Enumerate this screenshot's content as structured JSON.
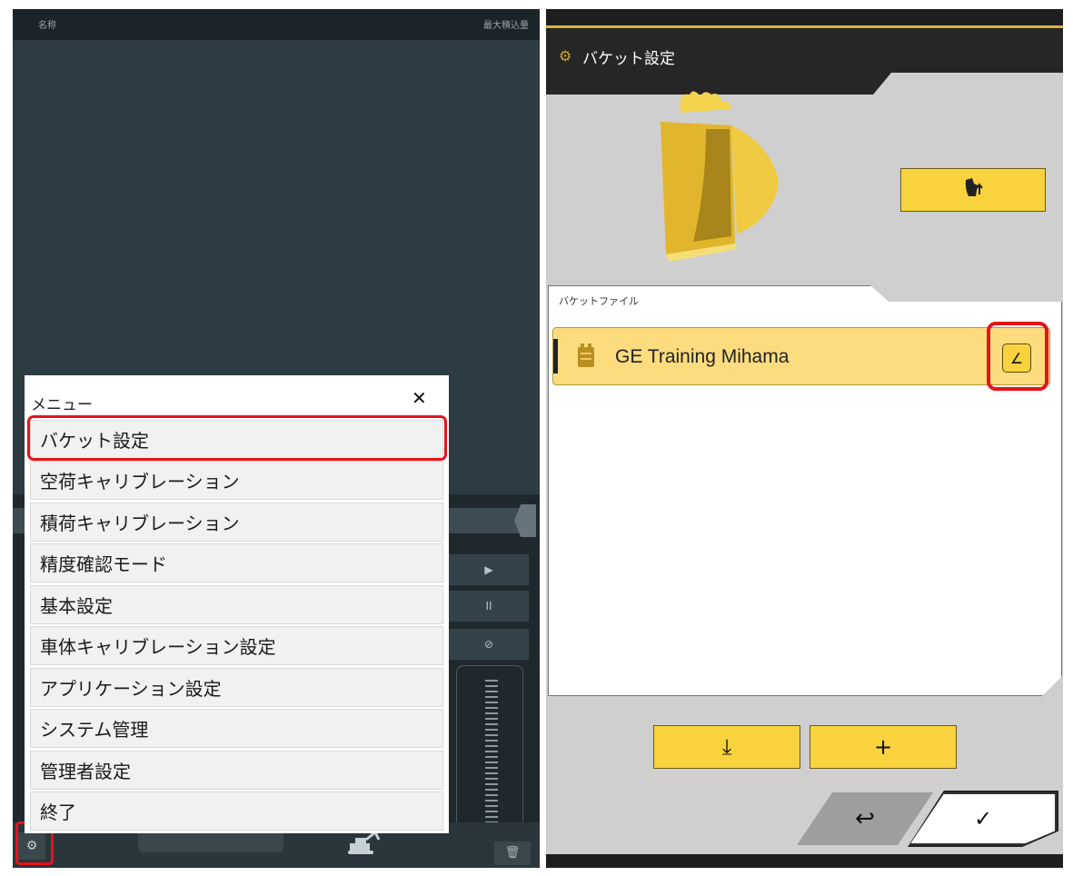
{
  "left_panel": {
    "header": {
      "name_label": "名称",
      "max_load_label": "最大積込量"
    },
    "menu": {
      "title": "メニュー",
      "close_glyph": "✕",
      "items": [
        {
          "label": "バケット設定"
        },
        {
          "label": "空荷キャリブレーション"
        },
        {
          "label": "積荷キャリブレーション"
        },
        {
          "label": "精度確認モード"
        },
        {
          "label": "基本設定"
        },
        {
          "label": "車体キャリブレーション設定"
        },
        {
          "label": "アプリケーション設定"
        },
        {
          "label": "システム管理"
        },
        {
          "label": "管理者設定"
        },
        {
          "label": "終了"
        }
      ]
    },
    "side_buttons": {
      "play": "▶",
      "pause": "II",
      "link": "⊘"
    },
    "icons": {
      "settings": "gear-icon",
      "trash": "trash-icon"
    }
  },
  "right_panel": {
    "title": "バケット設定",
    "file_section_label": "バケットファイル",
    "file": {
      "name": "GE Training Mihama"
    },
    "buttons": {
      "download": "⤓",
      "add": "+",
      "back": "↩",
      "ok": "✓",
      "edit": "∠"
    },
    "colors": {
      "accent_yellow": "#f8d33e",
      "file_item_bg": "#fcdc7f",
      "highlight_red": "#e5141a"
    }
  }
}
